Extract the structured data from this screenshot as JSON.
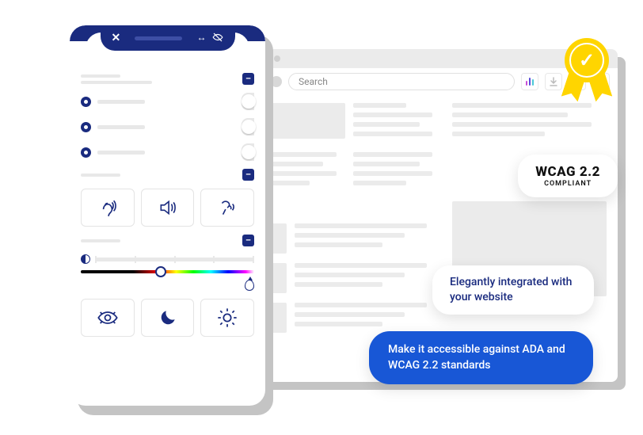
{
  "browser": {
    "search_placeholder": "Search"
  },
  "widget": {
    "close_label": "✕",
    "resize_label": "↔",
    "visibility_label": "◐",
    "minus_label": "–"
  },
  "badges": {
    "wcag_title": "WCAG 2.2",
    "wcag_sub": "COMPLIANT",
    "elegant": "Elegantly integrated with your website",
    "ada": "Make it accessible against ADA and WCAG 2.2 standards"
  }
}
